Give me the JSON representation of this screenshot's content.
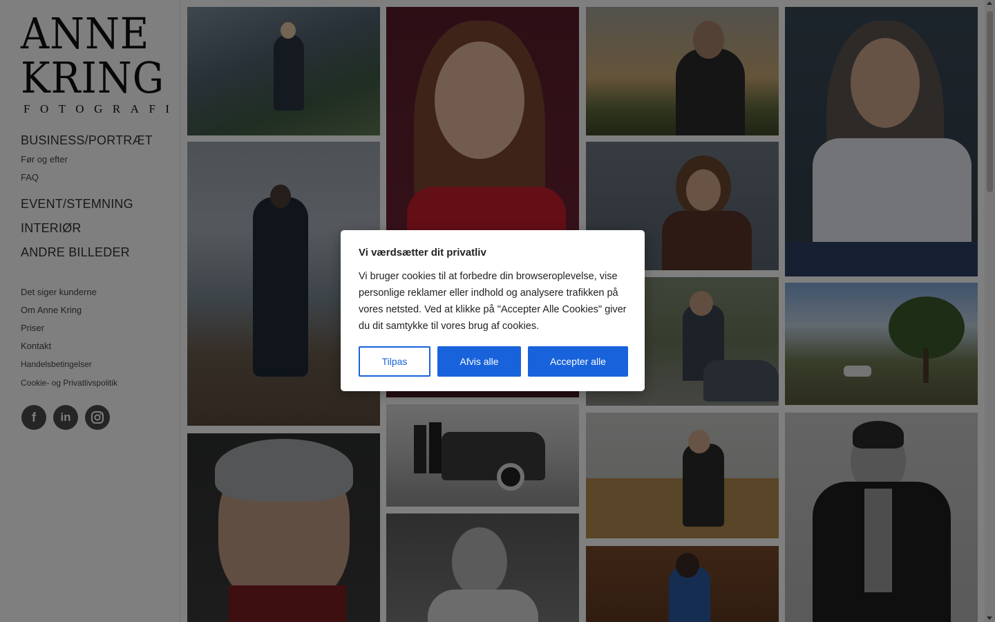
{
  "logo": {
    "line1": "ANNE",
    "line2": "KRING",
    "sub": "FOTOGRAFI"
  },
  "nav": {
    "business": "BUSINESS/PORTRÆT",
    "before_after": "Før og efter",
    "faq": "FAQ",
    "event": "EVENT/STEMNING",
    "interior": "INTERIØR",
    "other": "ANDRE BILLEDER",
    "testimonials": "Det siger kunderne",
    "about": "Om Anne Kring",
    "prices": "Priser",
    "contact": "Kontakt",
    "terms": "Handelsbetingelser",
    "privacy": "Cookie- og Privatlivspolitik"
  },
  "social": {
    "facebook": "f",
    "linkedin": "in"
  },
  "cookie": {
    "title": "Vi værdsætter dit privatliv",
    "text": "Vi bruger cookies til at forbedre din browseroplevelse, vise personlige reklamer eller indhold og analysere trafikken på vores netsted. Ved at klikke på \"Accepter Alle Cookies\" giver du dit samtykke til vores brug af cookies.",
    "customize": "Tilpas",
    "reject": "Afvis alle",
    "accept": "Accepter alle"
  },
  "colors": {
    "accent": "#1863dc",
    "overlay": "rgba(0,0,0,0.5)"
  }
}
